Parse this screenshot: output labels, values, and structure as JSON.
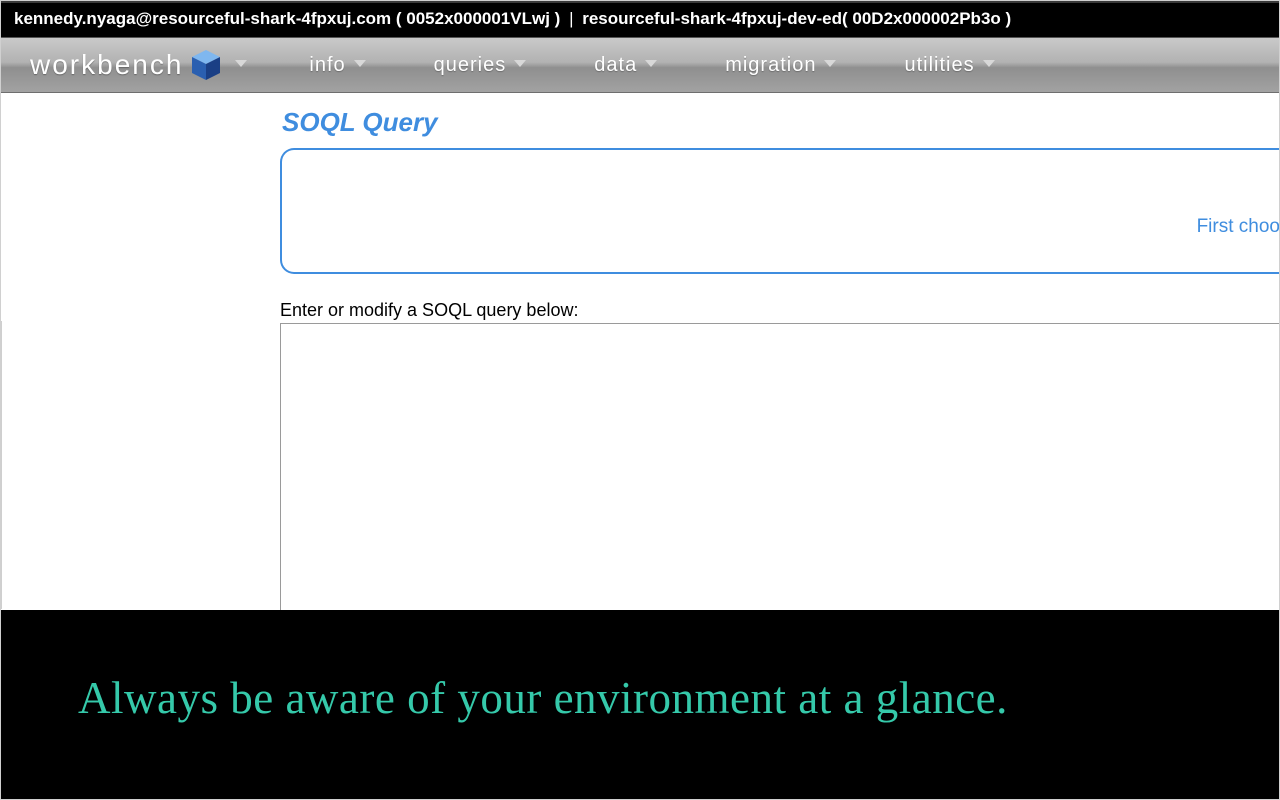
{
  "topbar": {
    "user": "kennedy.nyaga@resourceful-shark-4fpxuj.com ( 0052x000001VLwj )",
    "separator": "|",
    "org": "resourceful-shark-4fpxuj-dev-ed( 00D2x000002Pb3o )"
  },
  "brand": "workbench",
  "menu": {
    "info": "info",
    "queries": "queries",
    "data": "data",
    "migration": "migration",
    "utilities": "utilities"
  },
  "page": {
    "title": "SOQL Query",
    "builder_hint": "First choo",
    "prompt": "Enter or modify a SOQL query below:"
  },
  "caption": "Always be aware of your environment at a glance."
}
